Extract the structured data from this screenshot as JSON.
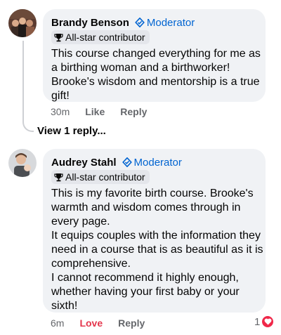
{
  "comments": [
    {
      "author": "Brandy Benson",
      "moderator_label": "Moderator",
      "badge": "All-star contributor",
      "lines": [
        "This course changed everything for me as",
        "a birthing woman and a birthworker!",
        "Brooke's wisdom and mentorship is a true",
        "gift!"
      ],
      "time": "30m",
      "like_label": "Like",
      "reply_label": "Reply"
    },
    {
      "author": "Audrey Stahl",
      "moderator_label": "Moderator",
      "badge": "All-star contributor",
      "lines": [
        "This is my favorite birth course. Brooke's",
        "warmth and wisdom comes through in",
        "every page.",
        "It equips couples with the information they",
        "need in a course that is as beautiful as it is",
        "comprehensive.",
        "I cannot recommend it highly enough,",
        "whether having your first baby or your",
        "sixth!"
      ],
      "time": "6m",
      "love_label": "Love",
      "reply_label": "Reply",
      "reaction_count": "1"
    }
  ],
  "view_replies": "View 1 reply...",
  "icons": {
    "moderator": "shield-icon",
    "badge": "trophy-icon",
    "reaction": "heart-icon"
  },
  "colors": {
    "moderator_blue": "#0064d1",
    "love_red": "#e4364c",
    "bubble_bg": "#f0f2f5",
    "meta_gray": "#65676b"
  }
}
